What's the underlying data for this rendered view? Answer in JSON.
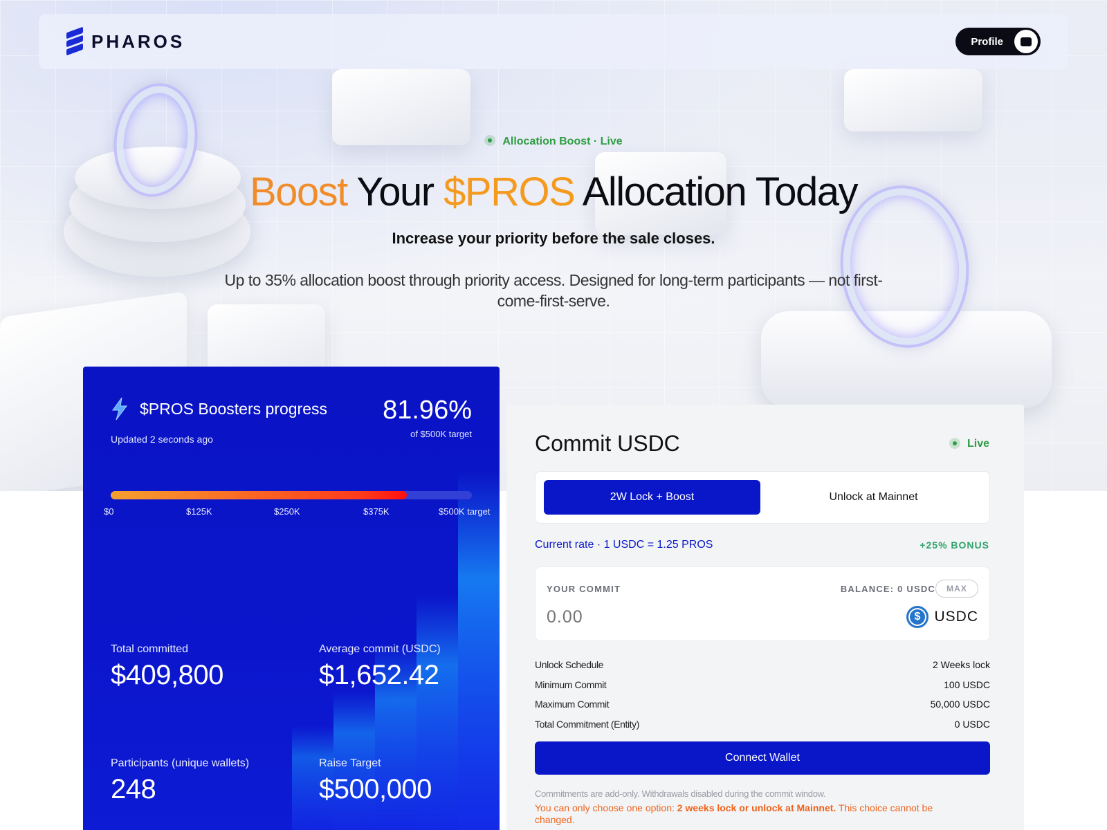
{
  "nav": {
    "brand": "PHAROS",
    "profile_label": "Profile"
  },
  "hero": {
    "badge": "Allocation Boost · Live",
    "headline": {
      "word1": "Boost",
      "word2": " Your ",
      "word3": "$PROS",
      "word4": " Allocation Today"
    },
    "subhead": "Increase your priority before the sale closes.",
    "description": "Up to 35% allocation boost through priority access. Designed for long-term participants — not first-come-first-serve."
  },
  "progress": {
    "title": "$PROS Boosters progress",
    "updated": "Updated 2 seconds ago",
    "percent_text": "81.96%",
    "percent_value": 81.96,
    "target_text": "of $500K target",
    "ticks": [
      "$0",
      "$125K",
      "$250K",
      "$375K",
      "$500K target"
    ],
    "stats": {
      "total_committed_label": "Total committed",
      "total_committed_value": "$409,800",
      "average_commit_label": "Average commit (USDC)",
      "average_commit_value": "$1,652.42",
      "participants_label": "Participants (unique wallets)",
      "participants_value": "248",
      "raise_target_label": "Raise Target",
      "raise_target_value": "$500,000"
    }
  },
  "commit": {
    "title": "Commit USDC",
    "status": "Live",
    "options": [
      "2W Lock + Boost",
      "Unlock at Mainnet"
    ],
    "rate": "Current rate · 1 USDC = 1.25 PROS",
    "bonus": "+25% BONUS",
    "input": {
      "label": "YOUR COMMIT",
      "balance": "BALANCE: 0 USDC",
      "max_label": "MAX",
      "placeholder": "0.00",
      "token": "USDC"
    },
    "details": [
      {
        "key": "Unlock Schedule",
        "value": "2 Weeks lock"
      },
      {
        "key": "Minimum Commit",
        "value": "100 USDC"
      },
      {
        "key": "Maximum Commit",
        "value": "50,000 USDC"
      },
      {
        "key": "Total Commitment (Entity)",
        "value": "0 USDC"
      }
    ],
    "connect_label": "Connect Wallet",
    "note1": "Commitments are add-only. Withdrawals disabled during the commit window.",
    "note2_a": "You can only choose one option: ",
    "note2_b": "2 weeks lock or unlock at Mainnet.",
    "note2_c": " This choice cannot be changed."
  },
  "colors": {
    "brand_blue": "#0a17c9",
    "accent_orange": "#f08c2a",
    "live_green": "#2f9d43",
    "bonus_green": "#2fa36a",
    "warning_orange": "#f0631b"
  }
}
